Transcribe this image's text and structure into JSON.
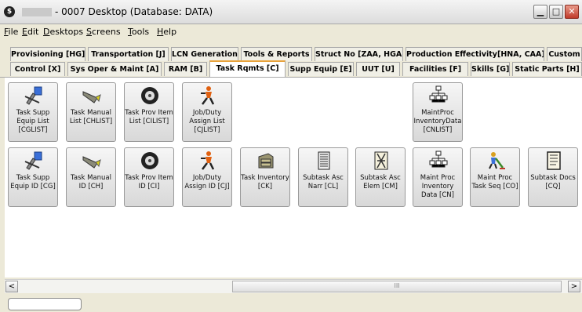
{
  "window": {
    "title": "- 0007 Desktop (Database: DATA)",
    "app_icon": "$"
  },
  "menubar": {
    "items": [
      {
        "key": "F",
        "rest": "ile"
      },
      {
        "key": "E",
        "rest": "dit"
      },
      {
        "key": "D",
        "rest": "esktops"
      },
      {
        "key": "S",
        "rest": "creens"
      },
      {
        "key": "T",
        "rest": "ools"
      },
      {
        "key": "H",
        "rest": "elp"
      }
    ]
  },
  "tabs_row1": [
    "Provisioning [HG]",
    "Transportation [J]",
    "LCN Generation",
    "Tools & Reports",
    "Struct No [ZAA, HGA]",
    "Production Effectivity[HNA, CAA]",
    "Custom"
  ],
  "tabs_row2": [
    "Control [X]",
    "Sys Oper & Maint [A]",
    "RAM [B]",
    "Task Rqmts [C]",
    "Supp Equip [E]",
    "UUT [U]",
    "Facilities [F]",
    "Skills [G]",
    "Static Parts [H]"
  ],
  "active_tab": "Task Rqmts [C]",
  "tiles_row1": [
    {
      "label": "Task Supp Equip List [CGLIST]",
      "icon": "tools-icon"
    },
    {
      "label": "Task Manual List [CHLIST]",
      "icon": "manual-icon"
    },
    {
      "label": "Task Prov Item List [CILIST]",
      "icon": "wheel-icon"
    },
    {
      "label": "Job/Duty Assign List [CJLIST]",
      "icon": "worker-icon"
    },
    {
      "label": "MaintProc InventoryData [CNLIST]",
      "icon": "hierarchy-icon"
    }
  ],
  "tiles_row2": [
    {
      "label": "Task Supp Equip ID [CG]",
      "icon": "tools-icon"
    },
    {
      "label": "Task Manual ID [CH]",
      "icon": "manual-icon"
    },
    {
      "label": "Task Prov Item ID [CI]",
      "icon": "wheel-icon"
    },
    {
      "label": "Job/Duty Assign ID [CJ]",
      "icon": "worker-icon"
    },
    {
      "label": "Task Inventory [CK]",
      "icon": "cabinet-icon"
    },
    {
      "label": "Subtask Asc Narr [CL]",
      "icon": "building-icon"
    },
    {
      "label": "Subtask Asc Elem [CM]",
      "icon": "ladder-icon"
    },
    {
      "label": "Maint Proc Inventory Data [CN]",
      "icon": "hierarchy-icon"
    },
    {
      "label": "Maint Proc Task Seq [CO]",
      "icon": "sweeper-icon"
    },
    {
      "label": "Subtask Docs [CQ]",
      "icon": "document-icon"
    }
  ],
  "scroll": {
    "left_arrow": "<",
    "right_arrow": ">",
    "grip": "III"
  }
}
